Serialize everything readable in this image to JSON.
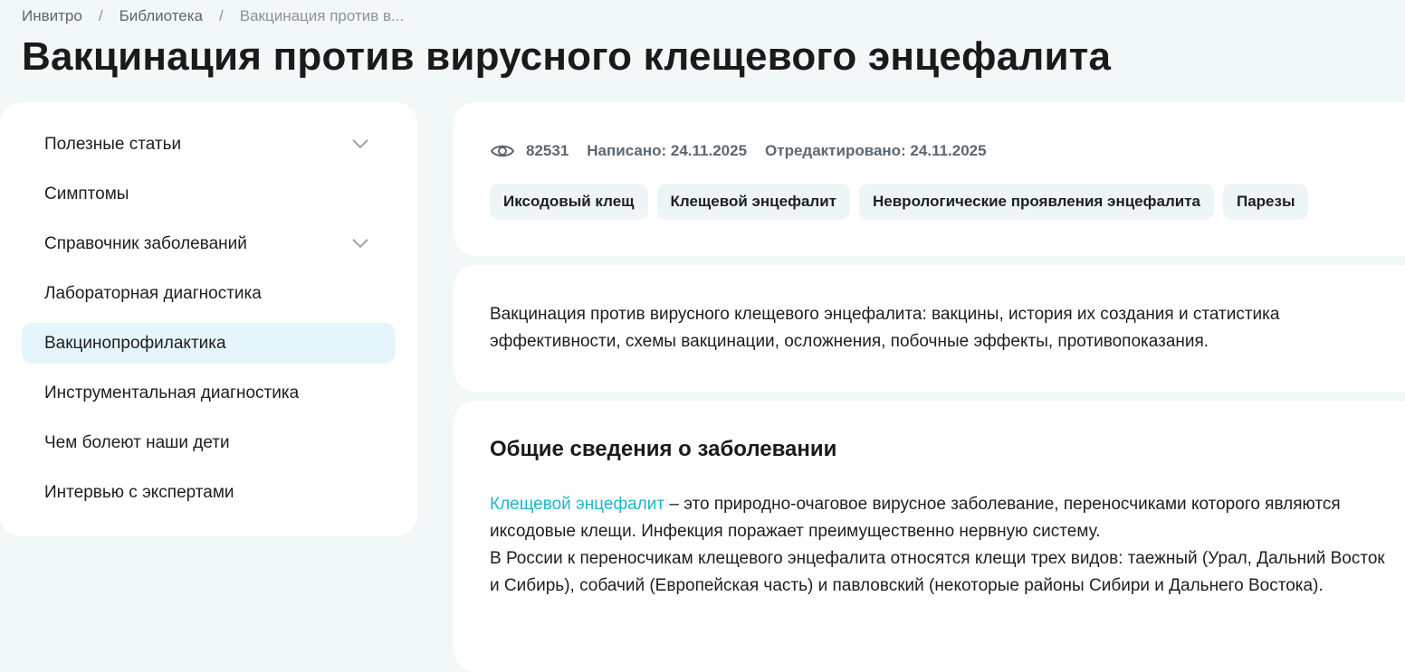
{
  "breadcrumb": {
    "items": [
      "Инвитро",
      "Библиотека"
    ],
    "current": "Вакцинация против в...",
    "separator": "/"
  },
  "page_title": "Вакцинация против вирусного клещевого энцефалита",
  "sidebar": {
    "items": [
      {
        "label": "Полезные статьи",
        "has_chevron": true
      },
      {
        "label": "Симптомы"
      },
      {
        "label": "Справочник заболеваний",
        "has_chevron": true
      },
      {
        "label": "Лабораторная диагностика"
      },
      {
        "label": "Вакцинопрофилактика",
        "active": true
      },
      {
        "label": "Инструментальная диагностика"
      },
      {
        "label": "Чем болеют наши дети"
      },
      {
        "label": "Интервью с экспертами"
      }
    ]
  },
  "meta": {
    "views": "82531",
    "written": "Написано: 24.11.2025",
    "edited": "Отредактировано: 24.11.2025"
  },
  "tags": [
    "Иксодовый клещ",
    "Клещевой энцефалит",
    "Неврологические проявления энцефалита",
    "Парезы"
  ],
  "intro": "Вакцинация против вирусного клещевого энцефалита: вакцины, история их создания и статистика эффективности, схемы вакцинации, осложнения, побочные эффекты, противопоказания.",
  "section": {
    "title": "Общие сведения о заболевании",
    "link_text": "Клещевой энцефалит",
    "p1_rest": " – это природно-очаговое вирусное заболевание, переносчиками которого являются иксодовые клещи. Инфекция поражает преимущественно нервную систему.",
    "p2": "В России к переносчикам клещевого энцефалита относятся клещи трех видов: таежный (Урал, Дальний Восток и Сибирь), собачий (Европейская часть) и павловский (некоторые районы Сибири и Дальнего Востока)."
  },
  "colors": {
    "accent": "#1fb5c8",
    "active_bg": "#e4f6fb",
    "page_bg": "#f2f7f8"
  }
}
